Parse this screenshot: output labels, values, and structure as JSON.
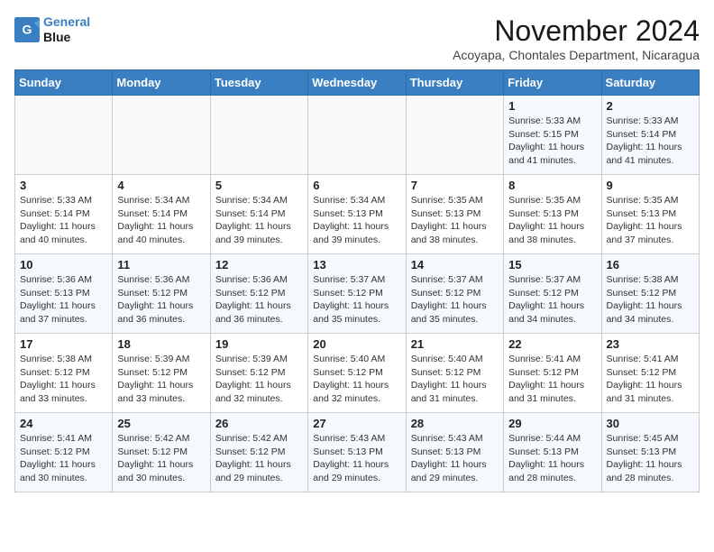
{
  "header": {
    "logo_line1": "General",
    "logo_line2": "Blue",
    "month_title": "November 2024",
    "location": "Acoyapa, Chontales Department, Nicaragua"
  },
  "weekdays": [
    "Sunday",
    "Monday",
    "Tuesday",
    "Wednesday",
    "Thursday",
    "Friday",
    "Saturday"
  ],
  "weeks": [
    [
      {
        "day": "",
        "detail": ""
      },
      {
        "day": "",
        "detail": ""
      },
      {
        "day": "",
        "detail": ""
      },
      {
        "day": "",
        "detail": ""
      },
      {
        "day": "",
        "detail": ""
      },
      {
        "day": "1",
        "detail": "Sunrise: 5:33 AM\nSunset: 5:15 PM\nDaylight: 11 hours\nand 41 minutes."
      },
      {
        "day": "2",
        "detail": "Sunrise: 5:33 AM\nSunset: 5:14 PM\nDaylight: 11 hours\nand 41 minutes."
      }
    ],
    [
      {
        "day": "3",
        "detail": "Sunrise: 5:33 AM\nSunset: 5:14 PM\nDaylight: 11 hours\nand 40 minutes."
      },
      {
        "day": "4",
        "detail": "Sunrise: 5:34 AM\nSunset: 5:14 PM\nDaylight: 11 hours\nand 40 minutes."
      },
      {
        "day": "5",
        "detail": "Sunrise: 5:34 AM\nSunset: 5:14 PM\nDaylight: 11 hours\nand 39 minutes."
      },
      {
        "day": "6",
        "detail": "Sunrise: 5:34 AM\nSunset: 5:13 PM\nDaylight: 11 hours\nand 39 minutes."
      },
      {
        "day": "7",
        "detail": "Sunrise: 5:35 AM\nSunset: 5:13 PM\nDaylight: 11 hours\nand 38 minutes."
      },
      {
        "day": "8",
        "detail": "Sunrise: 5:35 AM\nSunset: 5:13 PM\nDaylight: 11 hours\nand 38 minutes."
      },
      {
        "day": "9",
        "detail": "Sunrise: 5:35 AM\nSunset: 5:13 PM\nDaylight: 11 hours\nand 37 minutes."
      }
    ],
    [
      {
        "day": "10",
        "detail": "Sunrise: 5:36 AM\nSunset: 5:13 PM\nDaylight: 11 hours\nand 37 minutes."
      },
      {
        "day": "11",
        "detail": "Sunrise: 5:36 AM\nSunset: 5:12 PM\nDaylight: 11 hours\nand 36 minutes."
      },
      {
        "day": "12",
        "detail": "Sunrise: 5:36 AM\nSunset: 5:12 PM\nDaylight: 11 hours\nand 36 minutes."
      },
      {
        "day": "13",
        "detail": "Sunrise: 5:37 AM\nSunset: 5:12 PM\nDaylight: 11 hours\nand 35 minutes."
      },
      {
        "day": "14",
        "detail": "Sunrise: 5:37 AM\nSunset: 5:12 PM\nDaylight: 11 hours\nand 35 minutes."
      },
      {
        "day": "15",
        "detail": "Sunrise: 5:37 AM\nSunset: 5:12 PM\nDaylight: 11 hours\nand 34 minutes."
      },
      {
        "day": "16",
        "detail": "Sunrise: 5:38 AM\nSunset: 5:12 PM\nDaylight: 11 hours\nand 34 minutes."
      }
    ],
    [
      {
        "day": "17",
        "detail": "Sunrise: 5:38 AM\nSunset: 5:12 PM\nDaylight: 11 hours\nand 33 minutes."
      },
      {
        "day": "18",
        "detail": "Sunrise: 5:39 AM\nSunset: 5:12 PM\nDaylight: 11 hours\nand 33 minutes."
      },
      {
        "day": "19",
        "detail": "Sunrise: 5:39 AM\nSunset: 5:12 PM\nDaylight: 11 hours\nand 32 minutes."
      },
      {
        "day": "20",
        "detail": "Sunrise: 5:40 AM\nSunset: 5:12 PM\nDaylight: 11 hours\nand 32 minutes."
      },
      {
        "day": "21",
        "detail": "Sunrise: 5:40 AM\nSunset: 5:12 PM\nDaylight: 11 hours\nand 31 minutes."
      },
      {
        "day": "22",
        "detail": "Sunrise: 5:41 AM\nSunset: 5:12 PM\nDaylight: 11 hours\nand 31 minutes."
      },
      {
        "day": "23",
        "detail": "Sunrise: 5:41 AM\nSunset: 5:12 PM\nDaylight: 11 hours\nand 31 minutes."
      }
    ],
    [
      {
        "day": "24",
        "detail": "Sunrise: 5:41 AM\nSunset: 5:12 PM\nDaylight: 11 hours\nand 30 minutes."
      },
      {
        "day": "25",
        "detail": "Sunrise: 5:42 AM\nSunset: 5:12 PM\nDaylight: 11 hours\nand 30 minutes."
      },
      {
        "day": "26",
        "detail": "Sunrise: 5:42 AM\nSunset: 5:12 PM\nDaylight: 11 hours\nand 29 minutes."
      },
      {
        "day": "27",
        "detail": "Sunrise: 5:43 AM\nSunset: 5:13 PM\nDaylight: 11 hours\nand 29 minutes."
      },
      {
        "day": "28",
        "detail": "Sunrise: 5:43 AM\nSunset: 5:13 PM\nDaylight: 11 hours\nand 29 minutes."
      },
      {
        "day": "29",
        "detail": "Sunrise: 5:44 AM\nSunset: 5:13 PM\nDaylight: 11 hours\nand 28 minutes."
      },
      {
        "day": "30",
        "detail": "Sunrise: 5:45 AM\nSunset: 5:13 PM\nDaylight: 11 hours\nand 28 minutes."
      }
    ]
  ]
}
